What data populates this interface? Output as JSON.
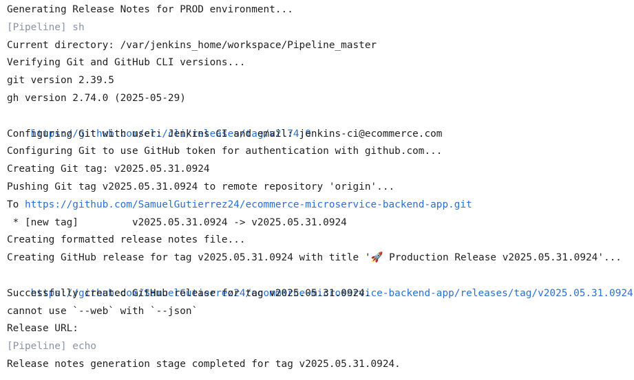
{
  "console": {
    "lines": [
      {
        "type": "text",
        "text": "Generating Release Notes for PROD environment..."
      },
      {
        "type": "step",
        "text": "[Pipeline] sh"
      },
      {
        "type": "text",
        "text": "Current directory: /var/jenkins_home/workspace/Pipeline_master"
      },
      {
        "type": "text",
        "text": "Verifying Git and GitHub CLI versions..."
      },
      {
        "type": "text",
        "text": "git version 2.39.5"
      },
      {
        "type": "text",
        "text": "gh version 2.74.0 (2025-05-29)"
      },
      {
        "type": "link",
        "text": "https://github.com/cli/cli/releases/tag/v2.74.0"
      },
      {
        "type": "text",
        "text": "Configuring Git with user: Jenkins CI and email: jenkins-ci@ecommerce.com"
      },
      {
        "type": "text",
        "text": "Configuring Git to use GitHub token for authentication with github.com..."
      },
      {
        "type": "text",
        "text": "Creating Git tag: v2025.05.31.0924"
      },
      {
        "type": "text",
        "text": "Pushing Git tag v2025.05.31.0924 to remote repository 'origin'..."
      },
      {
        "type": "mixed",
        "prefix": "To ",
        "link": "https://github.com/SamuelGutierrez24/ecommerce-microservice-backend-app.git"
      },
      {
        "type": "text",
        "text": " * [new tag]         v2025.05.31.0924 -> v2025.05.31.0924"
      },
      {
        "type": "text",
        "text": "Creating formatted release notes file..."
      },
      {
        "type": "text",
        "text": "Creating GitHub release for tag v2025.05.31.0924 with title '🚀 Production Release v2025.05.31.0924'..."
      },
      {
        "type": "link",
        "text": "https://github.com/SamuelGutierrez24/ecommerce-microservice-backend-app/releases/tag/v2025.05.31.0924"
      },
      {
        "type": "text",
        "text": "Successfully created GitHub release for tag v2025.05.31.0924."
      },
      {
        "type": "text",
        "text": "cannot use `--web` with `--json`"
      },
      {
        "type": "text",
        "text": "Release URL:"
      },
      {
        "type": "step",
        "text": "[Pipeline] echo"
      },
      {
        "type": "text",
        "text": "Release notes generation stage completed for tag v2025.05.31.0924."
      }
    ],
    "colors": {
      "text": "#1f1f1f",
      "pipeline_step": "#8a94a7",
      "link": "#2a6fd4",
      "background": "#ffffff"
    }
  }
}
